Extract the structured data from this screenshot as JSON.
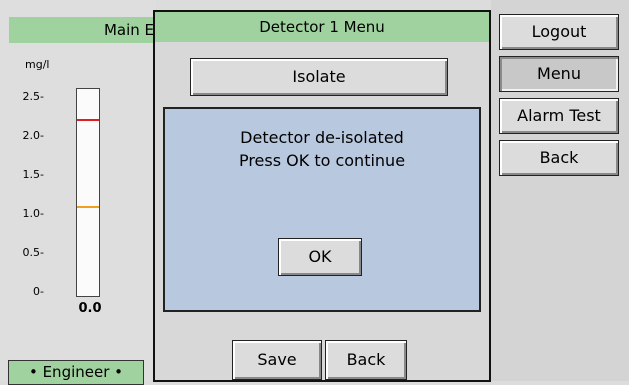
{
  "left_panel": {
    "header": "Main E",
    "unit": "mg/l",
    "ticks": [
      "2.5-",
      "2.0-",
      "1.5-",
      "1.0-",
      "0.5-",
      "0-"
    ],
    "alarm_high_color": "#e02020",
    "alarm_low_color": "#f0a020",
    "reading": "0.0",
    "role": "• Engineer •"
  },
  "menu": {
    "title": "Detector 1 Menu",
    "isolate_label": "Isolate",
    "save_label": "Save",
    "back_label": "Back"
  },
  "dialog": {
    "line1": "Detector de-isolated",
    "line2": "Press OK to continue",
    "ok_label": "OK"
  },
  "sidebar": {
    "items": [
      {
        "label": "Logout"
      },
      {
        "label": "Menu"
      },
      {
        "label": "Alarm Test"
      },
      {
        "label": "Back"
      }
    ]
  },
  "colors": {
    "header_green": "#9fd29f",
    "dialog_blue": "#b8c8de"
  }
}
